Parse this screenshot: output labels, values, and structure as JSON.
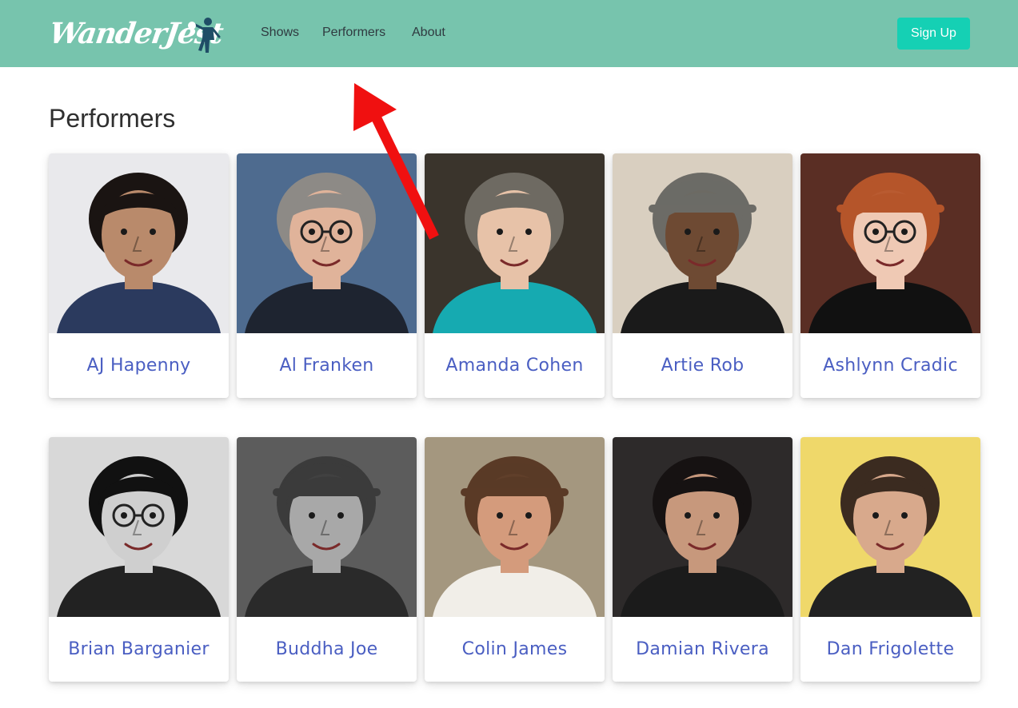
{
  "brand": {
    "logo_text": "WanderJest"
  },
  "nav": {
    "links": [
      "Shows",
      "Performers",
      "About"
    ],
    "signup_label": "Sign Up"
  },
  "page": {
    "title": "Performers"
  },
  "colors": {
    "navbar": "#77c4ad",
    "signup": "#15d0b4",
    "name_link": "#4a5ec2",
    "annotation_arrow": "#f01010"
  },
  "performers": [
    {
      "name": "AJ Hapenny",
      "bg": "#e9e9ec",
      "skin": "#b98a6b",
      "hair": "#1a1412",
      "shirt": "#2b3a5e",
      "glasses": false,
      "hat": false
    },
    {
      "name": "Al Franken",
      "bg": "#4e6b8f",
      "skin": "#e0b39a",
      "hair": "#8d8a86",
      "shirt": "#1e2430",
      "glasses": true,
      "hat": false
    },
    {
      "name": "Amanda Cohen",
      "bg": "#3a342c",
      "skin": "#e7c2a8",
      "hair": "#6e6a62",
      "shirt": "#16aab1",
      "glasses": false,
      "hat": false
    },
    {
      "name": "Artie Rob",
      "bg": "#d9cfc0",
      "skin": "#6e4a33",
      "hair": "#6c6b66",
      "shirt": "#1a1a1a",
      "glasses": false,
      "hat": true
    },
    {
      "name": "Ashlynn Cradic",
      "bg": "#5a2e24",
      "skin": "#efc9b4",
      "hair": "#b5552a",
      "shirt": "#111111",
      "glasses": true,
      "hat": true
    },
    {
      "name": "Brian Barganier",
      "bg": "#d8d8d8",
      "skin": "#cfcfcf",
      "hair": "#111111",
      "shirt": "#222222",
      "glasses": true,
      "hat": false
    },
    {
      "name": "Buddha Joe",
      "bg": "#5c5c5c",
      "skin": "#a8a8a8",
      "hair": "#3b3b3b",
      "shirt": "#2a2a2a",
      "glasses": false,
      "hat": true
    },
    {
      "name": "Colin James",
      "bg": "#a4977f",
      "skin": "#d49b7c",
      "hair": "#5a3a26",
      "shirt": "#f1eee8",
      "glasses": false,
      "hat": true
    },
    {
      "name": "Damian Rivera",
      "bg": "#2d2a2a",
      "skin": "#c7987c",
      "hair": "#161212",
      "shirt": "#1b1b1b",
      "glasses": false,
      "hat": false
    },
    {
      "name": "Dan Frigolette",
      "bg": "#efd86a",
      "skin": "#d8a98c",
      "hair": "#3b2b20",
      "shirt": "#222222",
      "glasses": false,
      "hat": false
    }
  ]
}
